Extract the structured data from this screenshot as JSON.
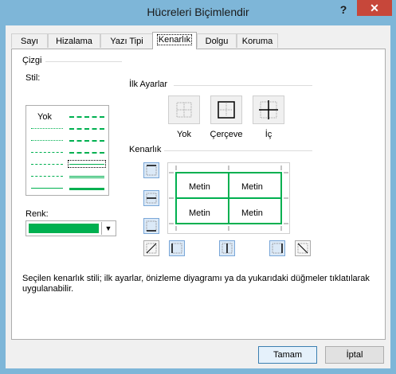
{
  "window": {
    "title": "Hücreleri Biçimlendir",
    "help": "?",
    "close": "✕"
  },
  "tabs": [
    {
      "label": "Sayı"
    },
    {
      "label": "Hizalama"
    },
    {
      "label": "Yazı Tipi"
    },
    {
      "label": "Kenarlık"
    },
    {
      "label": "Dolgu"
    },
    {
      "label": "Koruma"
    }
  ],
  "line_group": {
    "title": "Çizgi",
    "style_label": "Stil:",
    "none_label": "Yok",
    "color_label": "Renk:",
    "color_value": "#00b050"
  },
  "presets": {
    "title": "İlk Ayarlar",
    "items": [
      {
        "label": "Yok",
        "icon": "no-border-icon"
      },
      {
        "label": "Çerçeve",
        "icon": "outline-border-icon"
      },
      {
        "label": "İç",
        "icon": "inside-border-icon"
      }
    ]
  },
  "border": {
    "title": "Kenarlık",
    "cells": [
      "Metin",
      "Metin",
      "Metin",
      "Metin"
    ],
    "line_color": "#00b050"
  },
  "description": "Seçilen kenarlık stili; ilk ayarlar, önizleme diyagramı ya da yukarıdaki düğmeler tıklatılarak uygulanabilir.",
  "buttons": {
    "ok": "Tamam",
    "cancel": "İptal"
  }
}
